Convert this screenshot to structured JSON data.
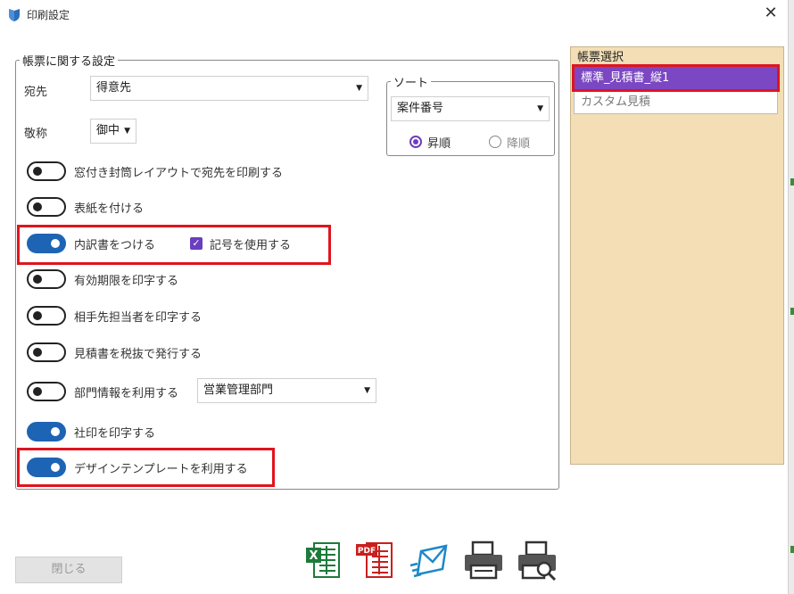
{
  "window": {
    "title": "印刷設定",
    "close_glyph": "✕"
  },
  "settings": {
    "legend": "帳票に関する設定",
    "recipient": {
      "label": "宛先",
      "value": "得意先"
    },
    "honorific": {
      "label": "敬称",
      "value": "御中"
    },
    "sort": {
      "legend": "ソート",
      "value": "案件番号",
      "asc_label": "昇順",
      "desc_label": "降順",
      "selected": "asc"
    },
    "toggles": [
      {
        "label": "窓付き封筒レイアウトで宛先を印刷する",
        "on": false
      },
      {
        "label": "表紙を付ける",
        "on": false
      },
      {
        "label": "内訳書をつける",
        "on": true
      },
      {
        "label": "有効期限を印字する",
        "on": false
      },
      {
        "label": "相手先担当者を印字する",
        "on": false
      },
      {
        "label": "見積書を税抜で発行する",
        "on": false
      },
      {
        "label": "部門情報を利用する",
        "on": false
      },
      {
        "label": "社印を印字する",
        "on": true
      },
      {
        "label": "デザインテンプレートを利用する",
        "on": true
      }
    ],
    "symbol_checkbox": {
      "label": "記号を使用する",
      "checked": true
    },
    "department": {
      "value": "営業管理部門"
    }
  },
  "report_select": {
    "legend": "帳票選択",
    "items": [
      {
        "label": "標準_見積書_縦1",
        "selected": true
      },
      {
        "label": "カスタム見積",
        "selected": false
      }
    ]
  },
  "footer": {
    "close_label": "閉じる",
    "excel_icon_text": "X",
    "pdf_icon_text": "PDF"
  },
  "colors": {
    "toggle_on": "#1e64b4",
    "selected_item": "#7b47c3",
    "highlight": "#e0141e",
    "report_panel": "#f3deb5"
  }
}
